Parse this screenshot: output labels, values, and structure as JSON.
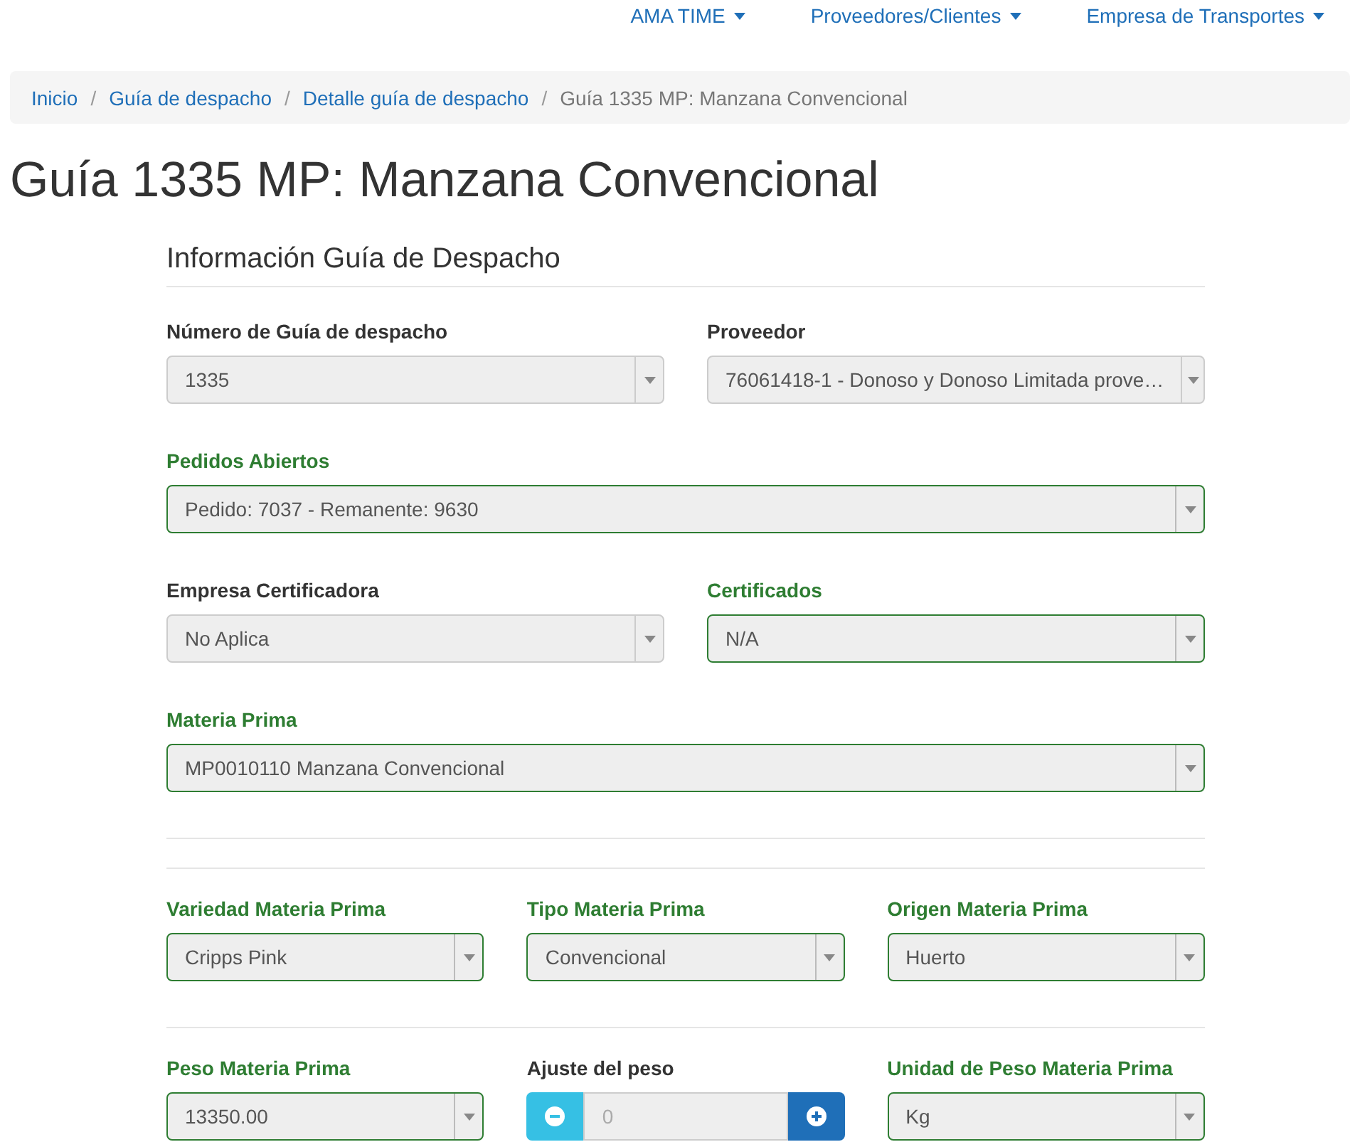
{
  "nav": [
    {
      "label": "AMA TIME"
    },
    {
      "label": "Proveedores/Clientes"
    },
    {
      "label": "Empresa de Transportes"
    }
  ],
  "breadcrumb": [
    {
      "label": "Inicio",
      "current": false
    },
    {
      "separator": "/",
      "label": "Guía de despacho",
      "current": false
    },
    {
      "separator": "/",
      "label": "Detalle guía de despacho",
      "current": false
    },
    {
      "separator": "/",
      "label": "Guía 1335 MP: Manzana Convencional",
      "current": true
    }
  ],
  "title": "Guía 1335 MP: Manzana Convencional",
  "section_title": "Información Guía de Despacho",
  "rows": [
    {
      "kind": "fields",
      "fields": [
        {
          "kind": "select",
          "label": "Número de Guía de despacho",
          "value": "1335",
          "valid": false
        },
        {
          "kind": "select",
          "label": "Proveedor",
          "value": "76061418-1 - Donoso y Donoso Limitada prove…",
          "valid": false
        }
      ]
    },
    {
      "kind": "fields",
      "fields": [
        {
          "kind": "select",
          "label": "Pedidos Abiertos",
          "value": "Pedido: 7037 - Remanente: 9630",
          "valid": true
        }
      ]
    },
    {
      "kind": "fields",
      "fields": [
        {
          "kind": "select",
          "label": "Empresa Certificadora",
          "value": "No Aplica",
          "valid": false
        },
        {
          "kind": "select",
          "label": "Certificados",
          "value": "N/A",
          "valid": true
        }
      ]
    },
    {
      "kind": "fields",
      "fields": [
        {
          "kind": "select",
          "label": "Materia Prima",
          "value": "MP0010110 Manzana Convencional",
          "valid": true
        }
      ]
    },
    {
      "kind": "divider"
    },
    {
      "kind": "divider"
    },
    {
      "kind": "fields",
      "fields": [
        {
          "kind": "select",
          "label": "Variedad Materia Prima",
          "value": "Cripps Pink",
          "valid": true
        },
        {
          "kind": "select",
          "label": "Tipo Materia Prima",
          "value": "Convencional",
          "valid": true
        },
        {
          "kind": "select",
          "label": "Origen Materia Prima",
          "value": "Huerto",
          "valid": true
        }
      ]
    },
    {
      "kind": "divider"
    },
    {
      "kind": "fields",
      "fields": [
        {
          "kind": "select",
          "label": "Peso Materia Prima",
          "value": "13350.00",
          "valid": true
        },
        {
          "kind": "stepper",
          "label": "Ajuste del peso",
          "placeholder": "0",
          "valid": false
        },
        {
          "kind": "select",
          "label": "Unidad de Peso Materia Prima",
          "value": "Kg",
          "valid": true
        }
      ]
    }
  ]
}
